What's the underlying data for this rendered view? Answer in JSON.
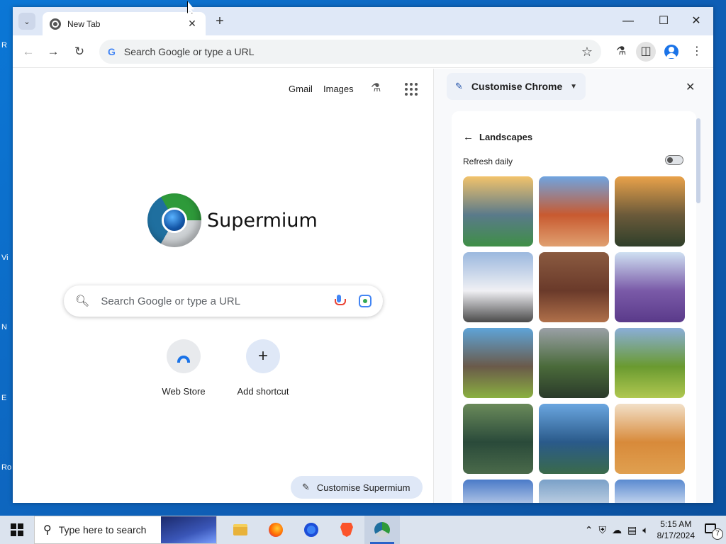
{
  "browser": {
    "tab": {
      "title": "New Tab"
    },
    "omnibox": {
      "placeholder": "Search Google or type a URL"
    }
  },
  "ntp": {
    "top_links": [
      "Gmail",
      "Images"
    ],
    "brand_name": "Supermium",
    "search_placeholder": "Search Google or type a URL",
    "shortcuts": [
      {
        "label": "Web Store"
      },
      {
        "label": "Add shortcut"
      }
    ],
    "customise_button": "Customise Supermium"
  },
  "side_panel": {
    "title": "Customise Chrome",
    "section": "Landscapes",
    "refresh_label": "Refresh daily",
    "refresh_on": false,
    "thumbnails": [
      {
        "colors": [
          "#f2c36b",
          "#5a7a8a",
          "#3f8f46"
        ]
      },
      {
        "colors": [
          "#6fa4e0",
          "#c85a30",
          "#e0a070"
        ]
      },
      {
        "colors": [
          "#e9a24a",
          "#6b5a3a",
          "#2f3f2a"
        ]
      },
      {
        "colors": [
          "#9bb8de",
          "#f0f0f4",
          "#4a4a4a"
        ]
      },
      {
        "colors": [
          "#8a5a40",
          "#6a3a2a",
          "#b0704a"
        ]
      },
      {
        "colors": [
          "#cfe0f2",
          "#7a5aa8",
          "#5a3a8a"
        ]
      },
      {
        "colors": [
          "#5ea4d8",
          "#6a5a4a",
          "#8ab040"
        ]
      },
      {
        "colors": [
          "#9aa0a6",
          "#4a6a3a",
          "#2a3a2a"
        ]
      },
      {
        "colors": [
          "#8aaed8",
          "#6a9a30",
          "#b0c850"
        ]
      },
      {
        "colors": [
          "#6a8a5a",
          "#2a4a3a",
          "#4a6a4a"
        ]
      },
      {
        "colors": [
          "#6aa6e0",
          "#2a5a8a",
          "#3a6a4a"
        ]
      },
      {
        "colors": [
          "#f2e0c8",
          "#d88a3a",
          "#e0a050"
        ]
      },
      {
        "colors": [
          "#4a7ac8",
          "#e8eef6",
          "#ffffff"
        ]
      },
      {
        "colors": [
          "#7aa0c8",
          "#e0e8f0",
          "#ffffff"
        ]
      },
      {
        "colors": [
          "#5a8ad0",
          "#ffffff",
          "#dce6f2"
        ]
      }
    ]
  },
  "taskbar": {
    "search_placeholder": "Type here to search",
    "time": "5:15 AM",
    "date": "8/17/2024",
    "notification_count": "7"
  }
}
